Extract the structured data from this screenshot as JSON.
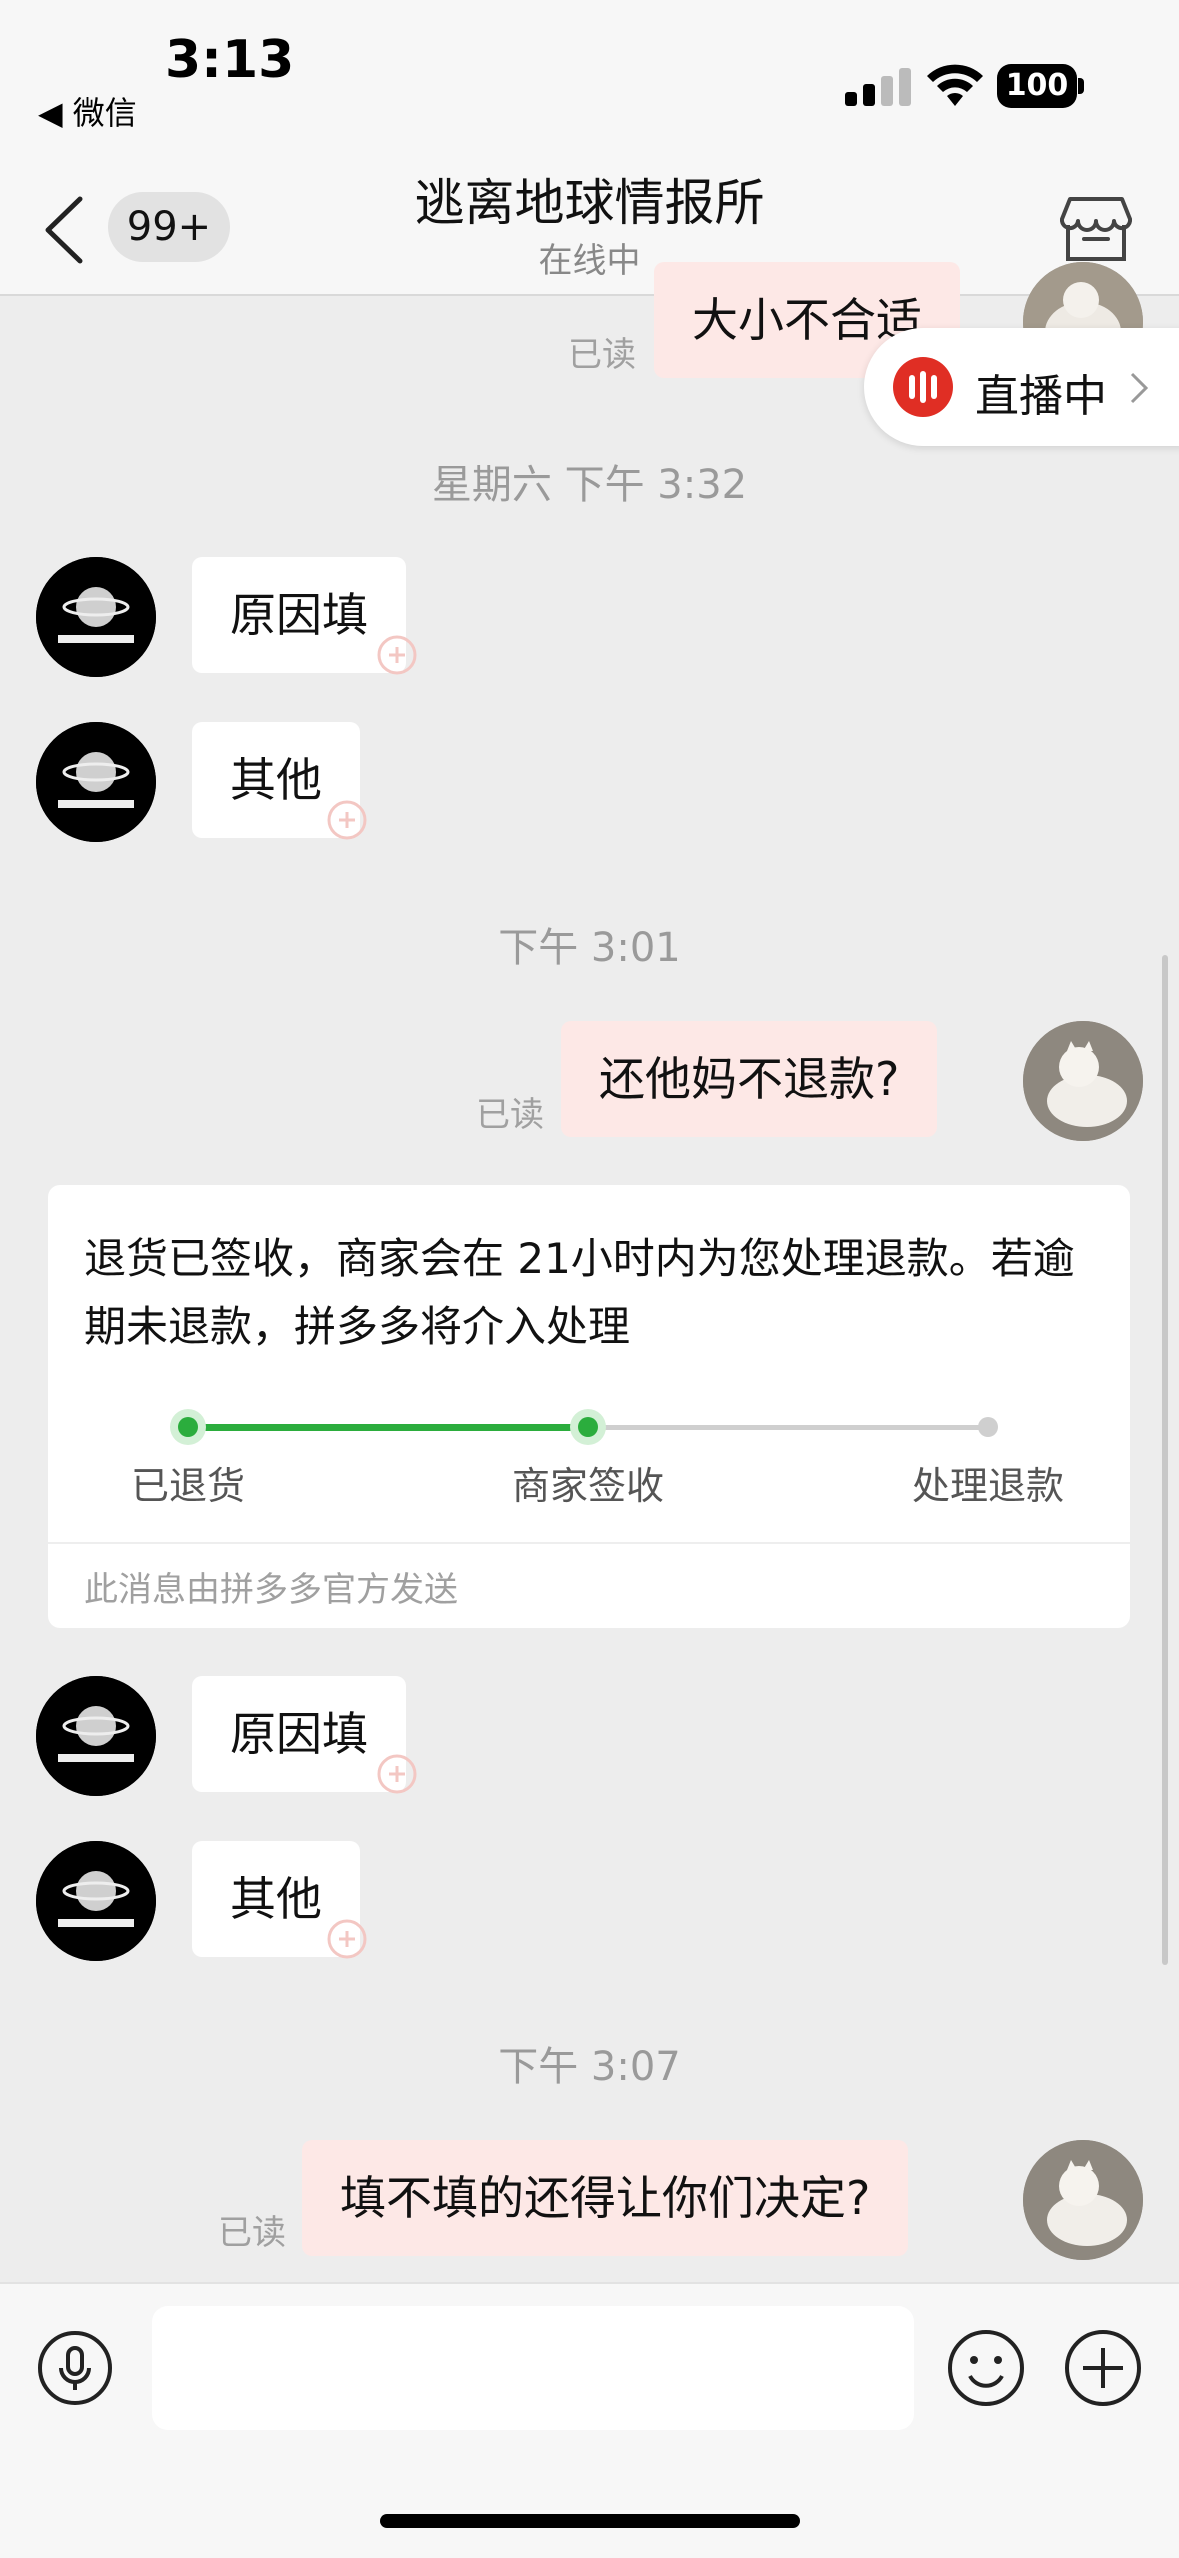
{
  "status_bar": {
    "time": "3:13",
    "back_app": "◀ 微信",
    "battery": "100"
  },
  "nav": {
    "unread_badge": "99+",
    "title": "逃离地球情报所",
    "subtitle": "在线中"
  },
  "live_pill": {
    "label": "直播中"
  },
  "messages": {
    "top_partial": {
      "read": "已读",
      "text": "大小不合适"
    },
    "ts1": "星期六 下午 3:32",
    "in1": "原因填",
    "in2": "其他",
    "ts2": "下午 3:01",
    "out1": {
      "read": "已读",
      "text": "还他妈不退款?"
    },
    "card": {
      "text": "退货已签收，商家会在 21小时内为您处理退款。若逾期未退款，拼多多将介入处理",
      "steps": [
        "已退货",
        "商家签收",
        "处理退款"
      ],
      "progress_step": 2,
      "footer": "此消息由拼多多官方发送"
    },
    "in3": "原因填",
    "in4": "其他",
    "ts3": "下午 3:07",
    "out2": {
      "read": "已读",
      "text": "填不填的还得让你们决定?"
    }
  },
  "colors": {
    "accent_green": "#2bad3d",
    "live_red": "#e02e24",
    "out_bubble": "#fde8e6"
  }
}
